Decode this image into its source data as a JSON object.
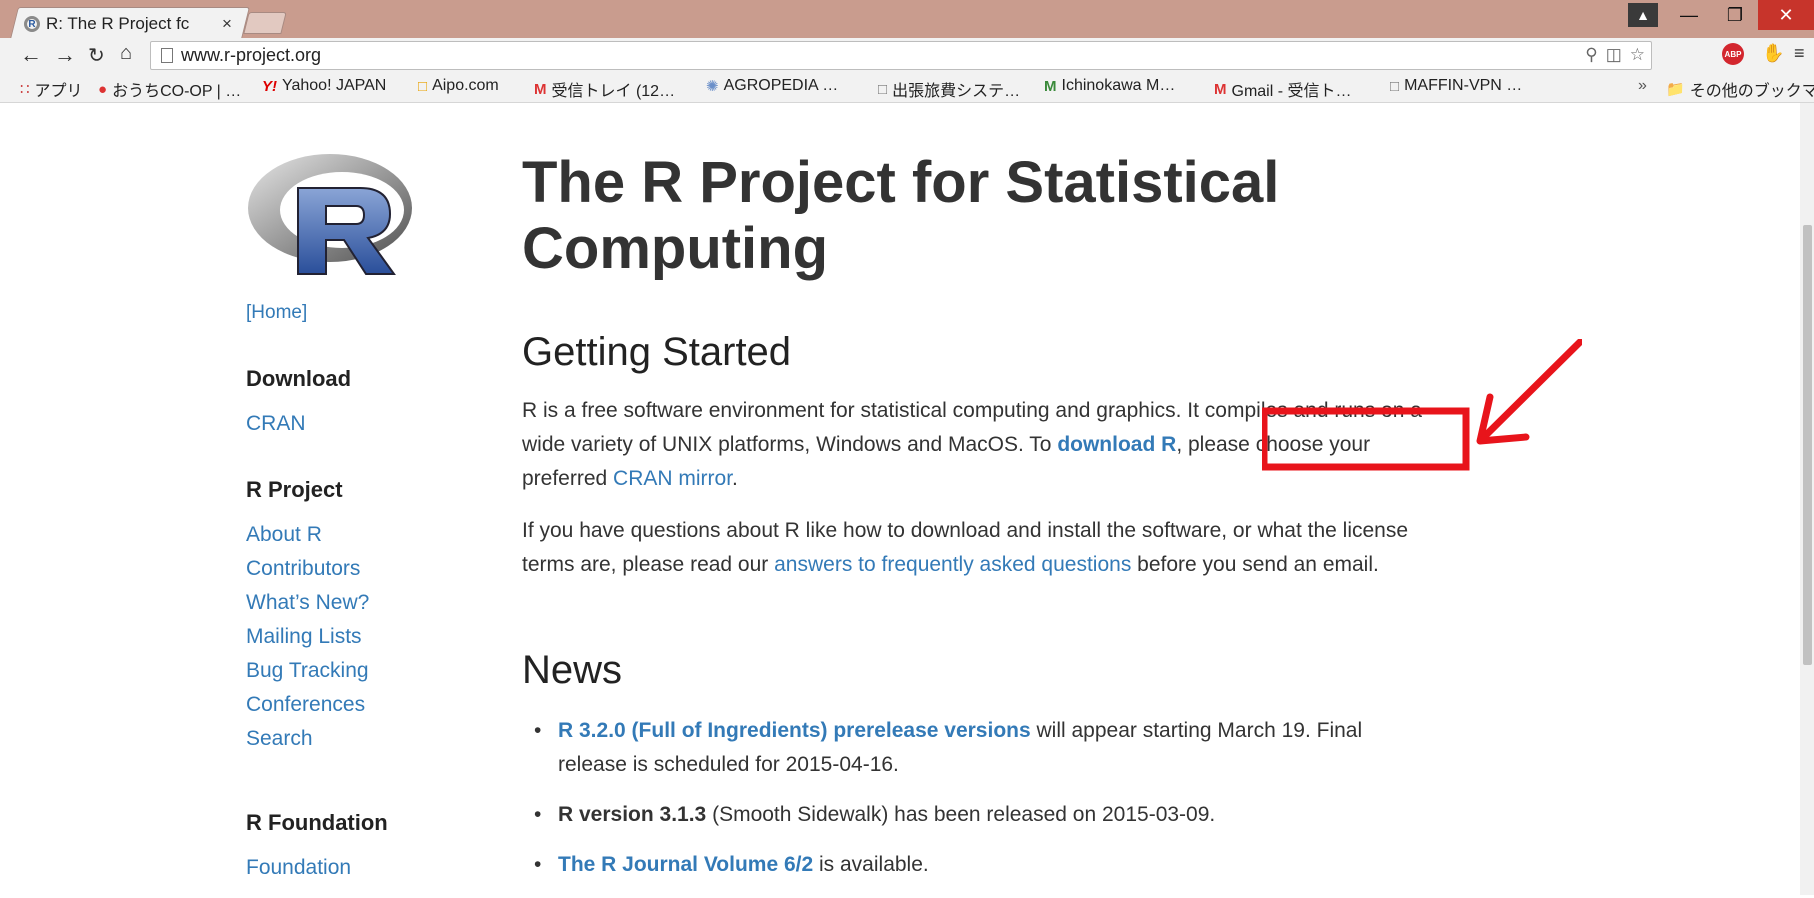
{
  "browser": {
    "tab_title": "R: The R Project fc",
    "tab_close": "×",
    "url": "www.r-project.org",
    "bookmarks": [
      {
        "label": "アプリ",
        "icon": "apps-grid-icon"
      },
      {
        "label": "おうちCO-OP | …",
        "icon": "coop-favicon"
      },
      {
        "label": "Yahoo! JAPAN",
        "icon": "yahoo-favicon"
      },
      {
        "label": "Aipo.com",
        "icon": "aipo-favicon"
      },
      {
        "label": "受信トレイ (12…",
        "icon": "gmail-favicon"
      },
      {
        "label": "AGROPEDIA …",
        "icon": "agropedia-favicon"
      },
      {
        "label": "出張旅費システ…",
        "icon": "page-icon"
      },
      {
        "label": "Ichinokawa M…",
        "icon": "m-favicon"
      },
      {
        "label": "Gmail - 受信ト…",
        "icon": "gmail-favicon"
      },
      {
        "label": "MAFFIN-VPN …",
        "icon": "page-icon"
      },
      {
        "label": "その他のブックマーク",
        "icon": "folder-icon"
      }
    ],
    "bookmarks_more": "»",
    "abp_label": "ABP"
  },
  "sidebar": {
    "home": "[Home]",
    "download_heading": "Download",
    "download_items": [
      "CRAN"
    ],
    "project_heading": "R Project",
    "project_items": [
      "About R",
      "Contributors",
      "What’s New?",
      "Mailing Lists",
      "Bug Tracking",
      "Conferences",
      "Search"
    ],
    "foundation_heading": "R Foundation",
    "foundation_items": [
      "Foundation"
    ]
  },
  "main": {
    "title": "The R Project for Statistical Computing",
    "getting_started": {
      "heading": "Getting Started",
      "p1_a": "R is a free software environment for statistical computing and graphics. It compiles and runs on a wide variety of UNIX platforms, Windows and MacOS. To ",
      "p1_link": "download R",
      "p1_b": ", please choose your preferred ",
      "p1_link2": "CRAN mirror",
      "p1_c": ".",
      "p2_a": "If you have questions about R like how to download and install the software, or what the license terms are, please read our ",
      "p2_link": "answers to frequently asked questions",
      "p2_b": " before you send an email."
    },
    "news": {
      "heading": "News",
      "items": [
        {
          "strong": "R 3.2.0 (Full of Ingredients) prerelease versions",
          "strong_is_link": true,
          "rest": " will appear starting March 19. Final release is scheduled for 2015-04-16."
        },
        {
          "strong": "R version 3.1.3",
          "strong_is_link": false,
          "rest": " (Smooth Sidewalk) has been released on 2015-03-09."
        },
        {
          "strong": "The R Journal Volume 6/2",
          "strong_is_link": true,
          "rest": " is available."
        }
      ]
    }
  },
  "colors": {
    "link": "#337ab7",
    "annotation": "#e8141b"
  }
}
